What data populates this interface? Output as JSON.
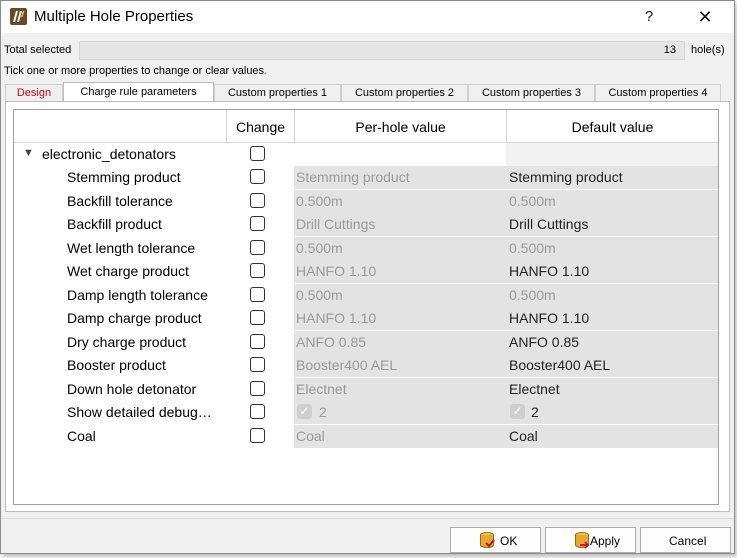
{
  "window": {
    "title": "Multiple Hole Properties",
    "help_glyph": "?",
    "close_glyph": "✕"
  },
  "summary": {
    "total_label": "Total selected",
    "total_value": "13",
    "holes_label": "hole(s)",
    "hint": "Tick one or more properties to change or clear values."
  },
  "tabs": [
    {
      "label": "Design",
      "active": false,
      "color": "#d0021b"
    },
    {
      "label": "Charge rule parameters",
      "active": true
    },
    {
      "label": "Custom properties 1",
      "active": false
    },
    {
      "label": "Custom properties 2",
      "active": false
    },
    {
      "label": "Custom properties 3",
      "active": false
    },
    {
      "label": "Custom properties 4",
      "active": false
    }
  ],
  "table": {
    "headers": {
      "change": "Change",
      "per_hole": "Per-hole value",
      "default": "Default value"
    },
    "group": {
      "name": "electronic_detonators",
      "expander": "▼"
    },
    "rows": [
      {
        "name": "Stemming product",
        "per_hole": "Stemming product",
        "default": "Stemming product"
      },
      {
        "name": "Backfill tolerance",
        "per_hole": "0.500m",
        "default": "0.500m"
      },
      {
        "name": "Backfill product",
        "per_hole": "Drill Cuttings",
        "default": "Drill Cuttings"
      },
      {
        "name": "Wet length tolerance",
        "per_hole": "0.500m",
        "default": "0.500m"
      },
      {
        "name": "Wet charge product",
        "per_hole": "HANFO 1.10",
        "default": "HANFO 1.10"
      },
      {
        "name": "Damp length tolerance",
        "per_hole": "0.500m",
        "default": "0.500m"
      },
      {
        "name": "Damp charge product",
        "per_hole": "HANFO 1.10",
        "default": "HANFO 1.10"
      },
      {
        "name": "Dry charge product",
        "per_hole": "ANFO 0.85",
        "default": "ANFO 0.85"
      },
      {
        "name": "Booster product",
        "per_hole": "Booster400 AEL",
        "default": "Booster400 AEL"
      },
      {
        "name": "Down hole detonator",
        "per_hole": "Electnet",
        "default": "Electnet"
      },
      {
        "name": "Show detailed debug…",
        "per_hole": "2",
        "default": "2"
      },
      {
        "name": "Coal",
        "per_hole": "Coal",
        "default": "Coal"
      }
    ]
  },
  "buttons": {
    "ok": "OK",
    "apply": "Apply",
    "cancel": "Cancel"
  }
}
